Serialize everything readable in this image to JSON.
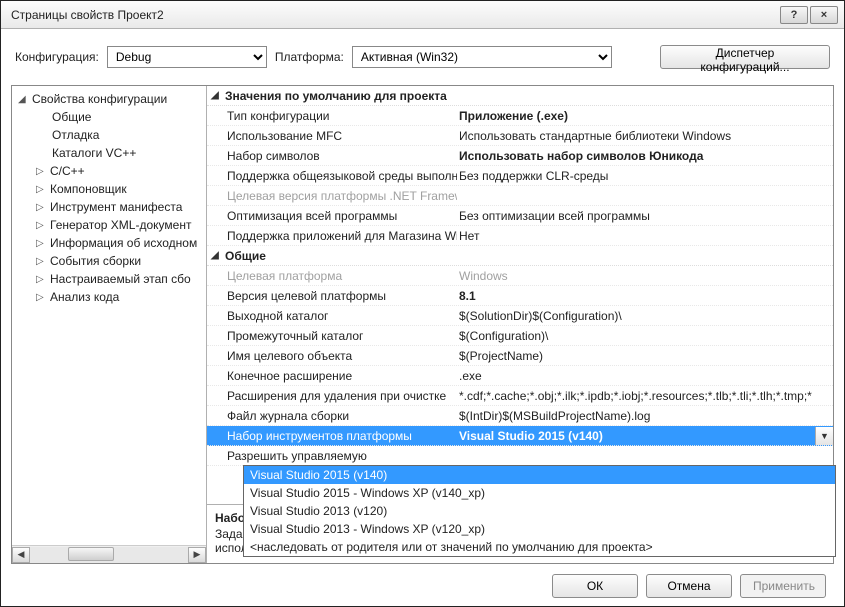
{
  "window": {
    "title": "Страницы свойств Проект2",
    "help": "?",
    "close": "×"
  },
  "top": {
    "config_label": "Конфигурация:",
    "config_value": "Debug",
    "platform_label": "Платформа:",
    "platform_value": "Активная (Win32)",
    "dispatcher": "Диспетчер конфигураций..."
  },
  "tree": {
    "root": "Свойства конфигурации",
    "items": [
      "Общие",
      "Отладка",
      "Каталоги VC++",
      "C/C++",
      "Компоновщик",
      "Инструмент манифеста",
      "Генератор XML-документ",
      "Информация об исходном",
      "События сборки",
      "Настраиваемый этап сбо",
      "Анализ кода"
    ]
  },
  "groups": [
    {
      "title": "Значения по умолчанию для проекта",
      "rows": [
        {
          "label": "Тип конфигурации",
          "value": "Приложение (.exe)",
          "bold": true
        },
        {
          "label": "Использование MFC",
          "value": "Использовать стандартные библиотеки Windows"
        },
        {
          "label": "Набор символов",
          "value": "Использовать набор символов Юникода",
          "bold": true
        },
        {
          "label": "Поддержка общеязыковой среды выполн",
          "value": "Без поддержки CLR-среды"
        },
        {
          "label": "Целевая версия платформы .NET Framewo",
          "value": "",
          "disabled": true
        },
        {
          "label": "Оптимизация всей программы",
          "value": "Без оптимизации всей программы"
        },
        {
          "label": "Поддержка приложений для Магазина Wi",
          "value": "Нет"
        }
      ]
    },
    {
      "title": "Общие",
      "rows": [
        {
          "label": "Целевая платформа",
          "value": "Windows",
          "disabled": true
        },
        {
          "label": "Версия целевой платформы",
          "value": "8.1",
          "bold": true
        },
        {
          "label": "Выходной каталог",
          "value": "$(SolutionDir)$(Configuration)\\"
        },
        {
          "label": "Промежуточный каталог",
          "value": "$(Configuration)\\"
        },
        {
          "label": "Имя целевого объекта",
          "value": "$(ProjectName)"
        },
        {
          "label": "Конечное расширение",
          "value": ".exe"
        },
        {
          "label": "Расширения для удаления при очистке",
          "value": "*.cdf;*.cache;*.obj;*.ilk;*.ipdb;*.iobj;*.resources;*.tlb;*.tli;*.tlh;*.tmp;*"
        },
        {
          "label": "Файл журнала сборки",
          "value": "$(IntDir)$(MSBuildProjectName).log"
        },
        {
          "label": "Набор инструментов платформы",
          "value": "Visual Studio 2015 (v140)",
          "bold": true,
          "selected": true,
          "caret": true
        },
        {
          "label": "Разрешить управляемую ",
          "value": ""
        }
      ]
    }
  ],
  "dropdown": {
    "items": [
      "Visual Studio 2015 (v140)",
      "Visual Studio 2015 - Windows XP (v140_xp)",
      "Visual Studio 2013 (v120)",
      "Visual Studio 2013 - Windows XP (v120_xp)",
      "<наследовать от родителя или от значений по умолчанию для проекта>"
    ],
    "selected": 0
  },
  "desc": {
    "title": "Набор инструментов платфо",
    "text": "Задает набор инструментов, используемый для сборки текущей конфигурации; если не указан, используется набор инструментов по умолчанию"
  },
  "footer": {
    "ok": "ОК",
    "cancel": "Отмена",
    "apply": "Применить"
  }
}
